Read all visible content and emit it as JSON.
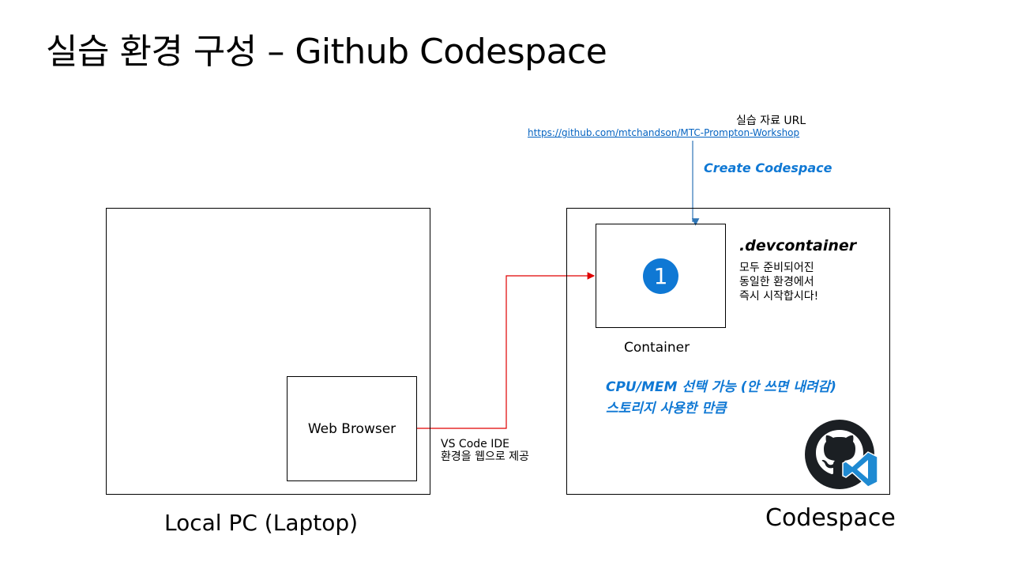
{
  "slide": {
    "title": "실습 환경 구성 – Github Codespace"
  },
  "local": {
    "label": "Local PC (Laptop)",
    "browser_label": "Web Browser"
  },
  "connection": {
    "vscode_line1": "VS Code IDE",
    "vscode_line2": "환경을 웹으로 제공"
  },
  "codespace": {
    "label": "Codespace",
    "container_label": "Container",
    "badge_number": "1",
    "devcontainer_title": ".devcontainer",
    "devcontainer_lines": [
      "모두 준비되어진",
      "동일한 환경에서",
      "즉시 시작합시다!"
    ],
    "note_line1": "CPU/MEM 선택 가능 (안 쓰면 내려감)",
    "note_line2": "스토리지 사용한 만큼"
  },
  "source": {
    "label": "실습 자료 URL",
    "url": "https://github.com/mtchandson/MTC-Prompton-Workshop",
    "action": "Create Codespace"
  },
  "icons": {
    "github": "github-octocat-icon",
    "vscode": "vscode-icon"
  },
  "colors": {
    "accent_blue": "#0f78d4",
    "link_blue": "#0563c1",
    "arrow_red": "#e00000",
    "arrow_blue": "#2e75b6"
  }
}
